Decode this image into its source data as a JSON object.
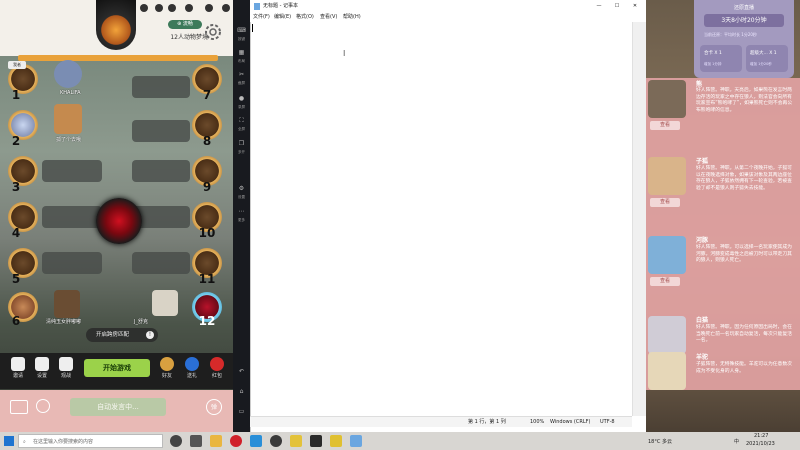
{
  "game": {
    "room_tag": "⊕ 流畅",
    "room_name": "12人动物梦境",
    "seats_left": [
      "1",
      "2",
      "3",
      "4",
      "5",
      "6"
    ],
    "seats_right": [
      "7",
      "8",
      "9",
      "10",
      "11",
      "12"
    ],
    "player_names": {
      "p1_badge": "我者",
      "p2": "KHALIFA",
      "p3": "孤了个去哦",
      "p6": "清纯玉女胖嘟嘟",
      "p12": "J_舒克"
    },
    "cross_room_label": "开启跨房匹配",
    "start_button": "开始游戏",
    "bottom_left": [
      "邀请",
      "设置",
      "观战"
    ],
    "bottom_right": [
      "好友",
      "送礼",
      "红包"
    ],
    "chat_placeholder": "自动发言中...",
    "chat_right_btn": "弹"
  },
  "emulator": {
    "items": [
      "按键",
      "布局",
      "截屏",
      "录屏",
      "全屏",
      "多开",
      "设置",
      "更多",
      "返回",
      "主页",
      "最近"
    ]
  },
  "notepad": {
    "title": "无标题 - 记事本",
    "menu": [
      "文件(F)",
      "编辑(E)",
      "格式(O)",
      "查看(V)",
      "帮助(H)"
    ],
    "status": {
      "position": "第 1 行，第 1 列",
      "zoom": "100%",
      "eol": "Windows (CRLF)",
      "encoding": "UTF-8"
    }
  },
  "live": {
    "title": "还原直播",
    "timer": "3天8小时20分钟",
    "subtitle": "当前还原：平均时长 1分20秒",
    "cards": [
      {
        "name": "合卡 X 1",
        "sub": "增加 1分钟"
      },
      {
        "name": "超级大... X 1",
        "sub": "增加 1分20秒"
      }
    ]
  },
  "roles": [
    {
      "name": "熊",
      "desc": "好人阵营。神职。天亮后，如果熊在发言时两边存活的玩家之中存在狼人，则法官会向所有玩家宣布“熊咆哮了”，如果熊死亡则不会再公布熊咆哮的信息。",
      "btn": "查看"
    },
    {
      "name": "子狐",
      "desc": "好人阵营。神职。从第二个夜晚开始，子狐可以在夜晚选择对象，如果该对象及其两边座位存在狼人，子狐依然拥有下一轮查验，若被查验了却不是狼人则子狐失去技能。",
      "btn": "查看"
    },
    {
      "name": "河豚",
      "desc": "好人阵营。神职。可以选择一名玩家使其成为河豚，河豚变成毒性之后被刀时可以带走刀其的狼人，则狼人死亡。",
      "btn": "查看"
    },
    {
      "name": "白猫",
      "desc": "好人阵营。神职。因为任何原因出局时，会在当晚死亡前一名玩家自动复活，每次只能复活一名。",
      "btn": "查看"
    },
    {
      "name": "羊驼",
      "desc": "子狐阵营，无特殊技能。羊驼可以为任意数次成为不受化身的人身。",
      "btn": "查看"
    }
  ],
  "taskbar": {
    "search_placeholder": "在这里输入你要搜索的内容",
    "weather": "18°C 多云",
    "time": "21:27",
    "date": "2021/10/23",
    "lang": "中"
  },
  "colors": {
    "start_button": "#9bd24a",
    "chat_bar": "#e8b9b5",
    "role_panel": "#dea0a0",
    "live_box": "#a39abf"
  }
}
